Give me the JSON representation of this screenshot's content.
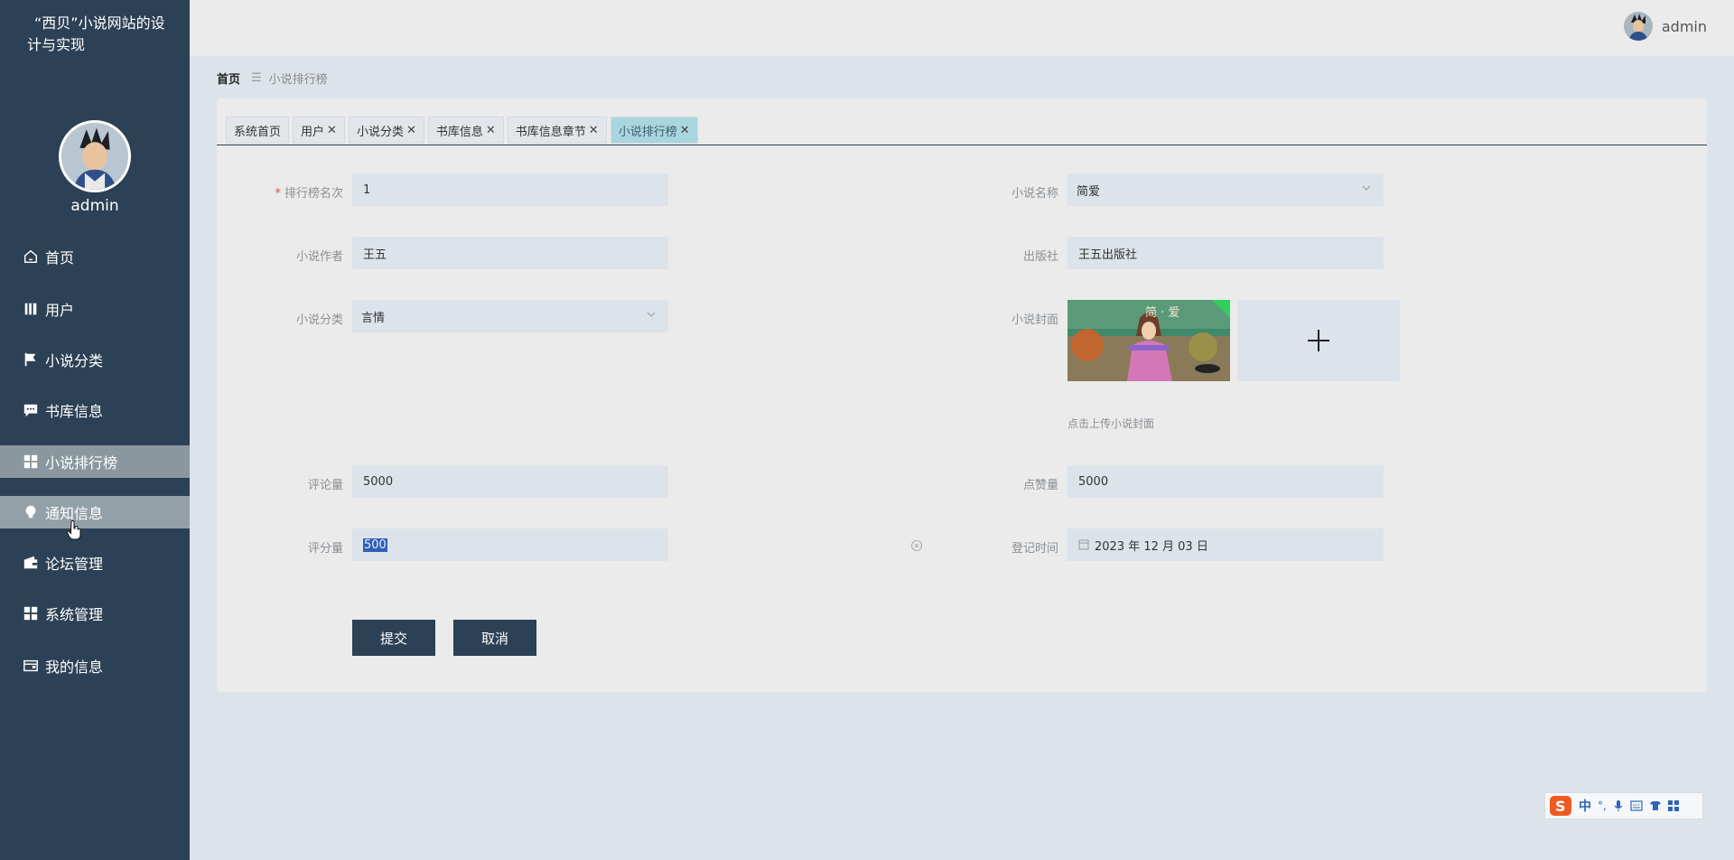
{
  "app": {
    "title": "“西贝”小说网站的设计与实现",
    "username": "admin"
  },
  "sidebar": {
    "items": [
      {
        "label": "首页",
        "icon": "home-icon"
      },
      {
        "label": "用户",
        "icon": "book-icon"
      },
      {
        "label": "小说分类",
        "icon": "flag-icon"
      },
      {
        "label": "书库信息",
        "icon": "message-icon"
      },
      {
        "label": "小说排行榜",
        "icon": "grid-icon"
      },
      {
        "label": "通知信息",
        "icon": "bulb-icon"
      },
      {
        "label": "论坛管理",
        "icon": "wallet-icon"
      },
      {
        "label": "系统管理",
        "icon": "grid-icon"
      },
      {
        "label": "我的信息",
        "icon": "card-icon"
      }
    ]
  },
  "header": {
    "username": "admin"
  },
  "breadcrumb": {
    "home": "首页",
    "current": "小说排行榜"
  },
  "tabs": [
    {
      "label": "系统首页",
      "closable": false
    },
    {
      "label": "用户",
      "closable": true
    },
    {
      "label": "小说分类",
      "closable": true
    },
    {
      "label": "书库信息",
      "closable": true
    },
    {
      "label": "书库信息章节",
      "closable": true
    },
    {
      "label": "小说排行榜",
      "closable": true
    }
  ],
  "form": {
    "rank_label": "排行榜名次",
    "rank_value": "1",
    "novel_name_label": "小说名称",
    "novel_name_value": "简爱",
    "author_label": "小说作者",
    "author_value": "王五",
    "publisher_label": "出版社",
    "publisher_value": "王五出版社",
    "category_label": "小说分类",
    "category_value": "言情",
    "cover_label": "小说封面",
    "cover_hint": "点击上传小说封面",
    "comments_label": "评论量",
    "comments_value": "5000",
    "likes_label": "点赞量",
    "likes_value": "5000",
    "rating_label": "评分量",
    "rating_value": "500",
    "date_label": "登记时间",
    "date_value": "2023 年 12 月 03 日",
    "submit_label": "提交",
    "cancel_label": "取消"
  },
  "ime": {
    "lang": "中"
  },
  "colors": {
    "sidebar": "#2c4155",
    "accent_tab": "#a8d6df",
    "input_bg": "#dde3ea"
  }
}
